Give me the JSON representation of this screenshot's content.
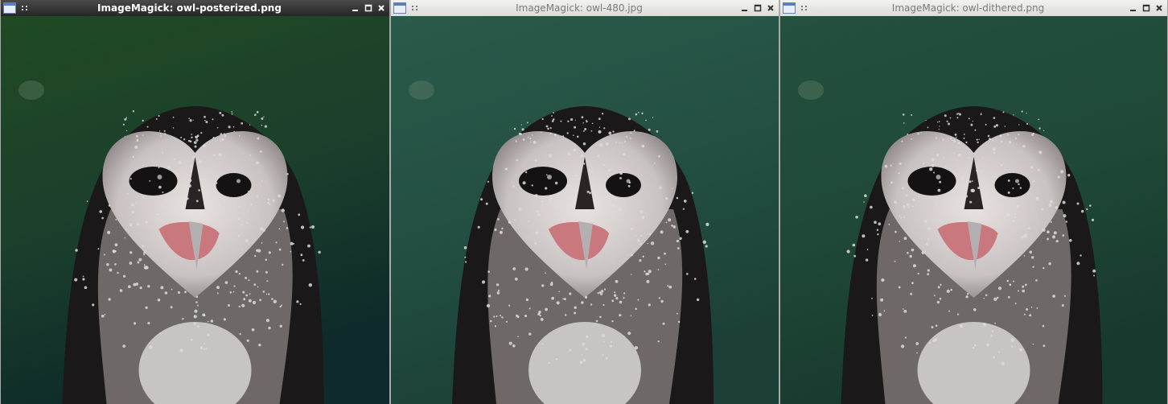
{
  "windows": [
    {
      "id": "posterized",
      "title": "ImageMagick: owl-posterized.png",
      "active": true,
      "image_desc": "posterized",
      "bg_top": "#1f4a24",
      "bg_mid": "#1b3f2c",
      "bg_bottom": "#0e2a2a"
    },
    {
      "id": "jpg",
      "title": "ImageMagick: owl-480.jpg",
      "active": false,
      "bg_top": "#2a5a4a",
      "bg_mid": "#234f42",
      "bg_bottom": "#1c4036"
    },
    {
      "id": "dithered",
      "title": "ImageMagick: owl-dithered.png",
      "active": false,
      "bg_top": "#24503f",
      "bg_mid": "#1f4838",
      "bg_bottom": "#173a2e"
    }
  ],
  "icons": {
    "window": "window-icon",
    "grip": "grip-icon",
    "minimize": "minimize-icon",
    "maximize": "maximize-icon",
    "close": "close-icon"
  }
}
